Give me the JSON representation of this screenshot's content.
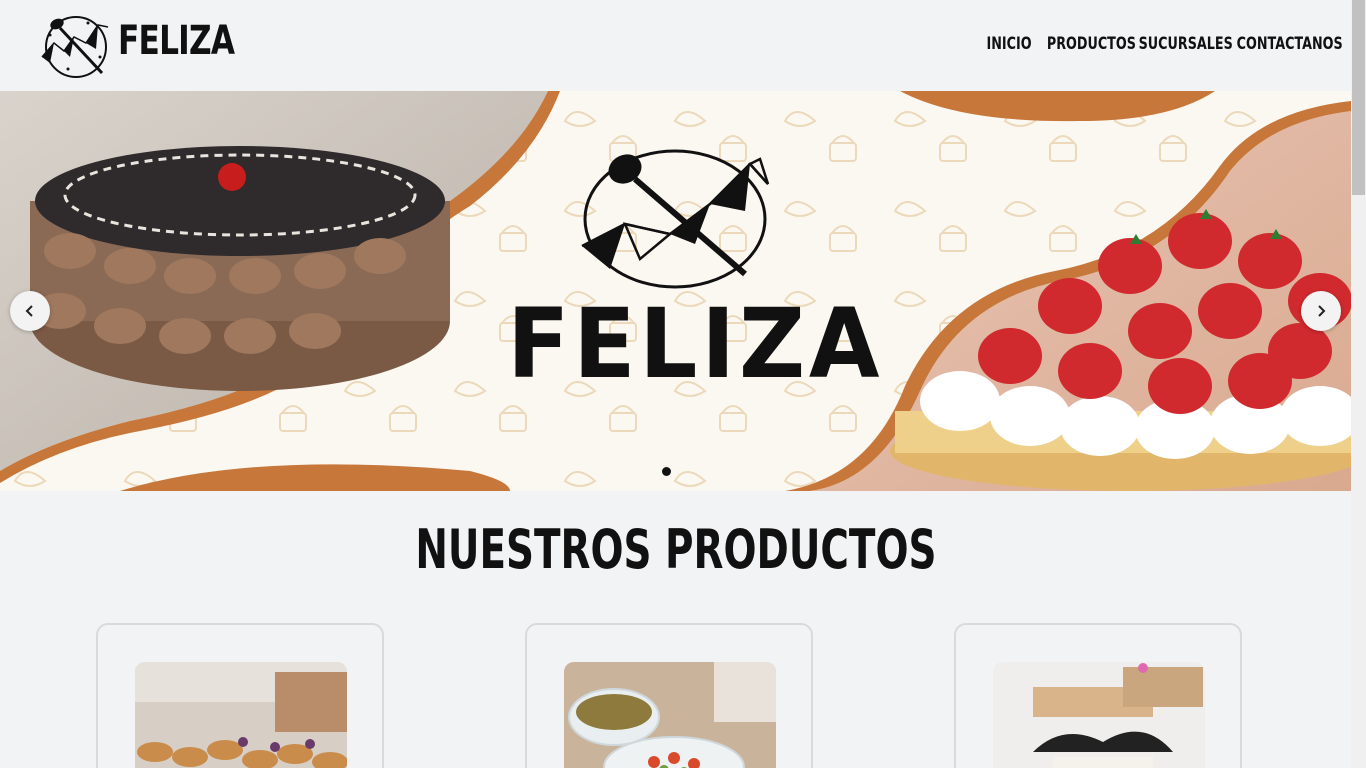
{
  "brand": {
    "name": "FELIZA"
  },
  "nav": {
    "items": [
      "INICIO",
      "PRODUCTOS",
      "SUCURSALES",
      "CONTACTANOS"
    ]
  },
  "carousel": {
    "banner_text": "FELIZA",
    "prev_icon": "chevron-left-icon",
    "next_icon": "chevron-right-icon",
    "active_slide": 1,
    "slide_count": 1
  },
  "products": {
    "title": "NUESTROS PRODUCTOS",
    "cards": [
      {
        "image": "pastries-display-photo"
      },
      {
        "image": "salads-photo"
      },
      {
        "image": "gift-cake-photo"
      }
    ]
  },
  "colors": {
    "accent": "#c8773a",
    "background": "#f2f3f5",
    "banner_bg": "#fbf8f1",
    "text": "#111111"
  }
}
